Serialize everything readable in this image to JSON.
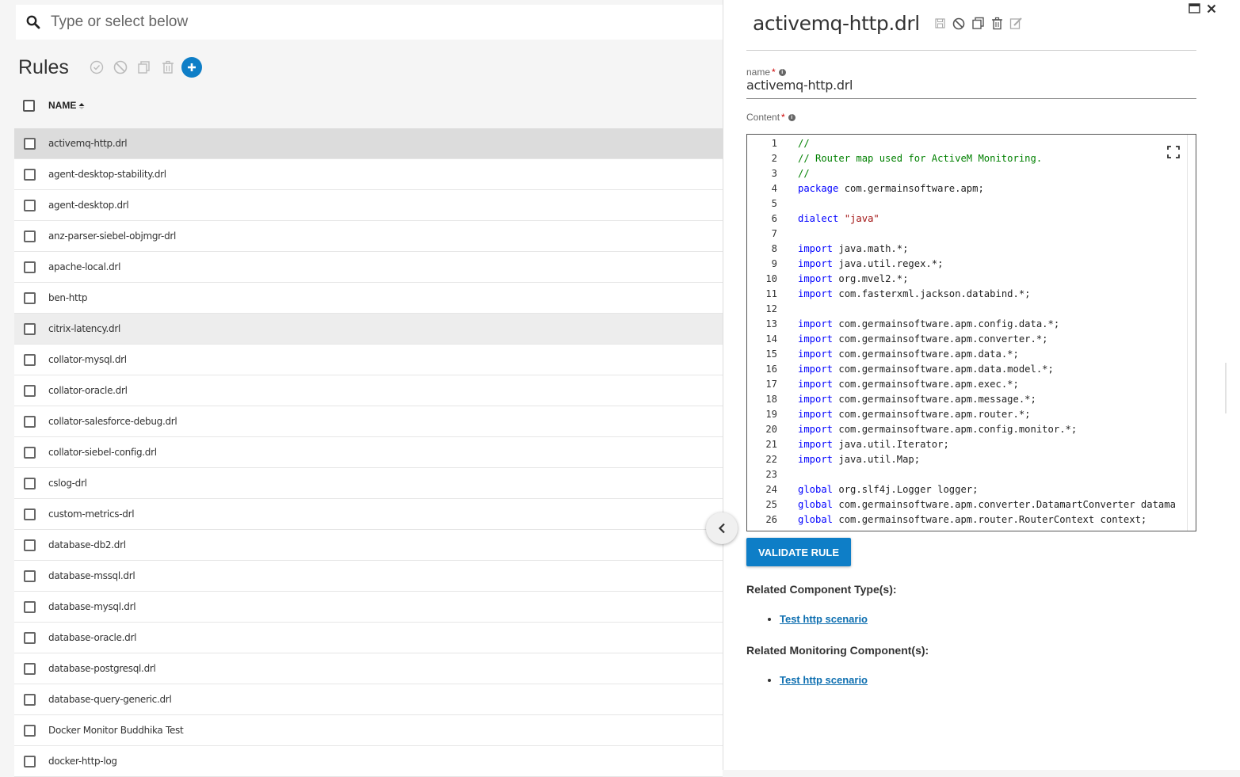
{
  "search": {
    "placeholder": "Type or select below"
  },
  "rules_panel": {
    "title": "Rules",
    "column_header": "NAME",
    "items": [
      "activemq-http.drl",
      "agent-desktop-stability.drl",
      "agent-desktop.drl",
      "anz-parser-siebel-objmgr-drl",
      "apache-local.drl",
      "ben-http",
      "citrix-latency.drl",
      "collator-mysql.drl",
      "collator-oracle.drl",
      "collator-salesforce-debug.drl",
      "collator-siebel-config.drl",
      "cslog-drl",
      "custom-metrics-drl",
      "database-db2.drl",
      "database-mssql.drl",
      "database-mysql.drl",
      "database-oracle.drl",
      "database-postgresql.drl",
      "database-query-generic.drl",
      "Docker Monitor Buddhika Test",
      "docker-http-log"
    ]
  },
  "detail": {
    "title": "activemq-http.drl",
    "name_label": "name",
    "name_value": "activemq-http.drl",
    "content_label": "Content",
    "required_mark": "*",
    "validate_label": "VALIDATE RULE",
    "related_component_types_heading": "Related Component Type(s):",
    "related_component_types": [
      "Test http scenario"
    ],
    "related_monitoring_components_heading": "Related Monitoring Component(s):",
    "related_monitoring_components": [
      "Test http scenario"
    ]
  },
  "code": {
    "line_numbers": [
      "1",
      "2",
      "3",
      "4",
      "5",
      "6",
      "7",
      "8",
      "9",
      "10",
      "11",
      "12",
      "13",
      "14",
      "15",
      "16",
      "17",
      "18",
      "19",
      "20",
      "21",
      "22",
      "23",
      "24",
      "25",
      "26"
    ],
    "lines": [
      {
        "kw": "",
        "text": "//",
        "type": "comment"
      },
      {
        "kw": "",
        "text": "// Router map used for ActiveM Monitoring.",
        "type": "comment"
      },
      {
        "kw": "",
        "text": "//",
        "type": "comment"
      },
      {
        "kw": "package",
        "text": " com.germainsoftware.apm;",
        "type": "code"
      },
      {
        "kw": "",
        "text": "",
        "type": "code"
      },
      {
        "kw": "dialect",
        "text": " ",
        "str": "\"java\"",
        "type": "code"
      },
      {
        "kw": "",
        "text": "",
        "type": "code"
      },
      {
        "kw": "import",
        "text": " java.math.*;",
        "type": "code"
      },
      {
        "kw": "import",
        "text": " java.util.regex.*;",
        "type": "code"
      },
      {
        "kw": "import",
        "text": " org.mvel2.*;",
        "type": "code"
      },
      {
        "kw": "import",
        "text": " com.fasterxml.jackson.databind.*;",
        "type": "code"
      },
      {
        "kw": "",
        "text": "",
        "type": "code"
      },
      {
        "kw": "import",
        "text": " com.germainsoftware.apm.config.data.*;",
        "type": "code"
      },
      {
        "kw": "import",
        "text": " com.germainsoftware.apm.converter.*;",
        "type": "code"
      },
      {
        "kw": "import",
        "text": " com.germainsoftware.apm.data.*;",
        "type": "code"
      },
      {
        "kw": "import",
        "text": " com.germainsoftware.apm.data.model.*;",
        "type": "code"
      },
      {
        "kw": "import",
        "text": " com.germainsoftware.apm.exec.*;",
        "type": "code"
      },
      {
        "kw": "import",
        "text": " com.germainsoftware.apm.message.*;",
        "type": "code"
      },
      {
        "kw": "import",
        "text": " com.germainsoftware.apm.router.*;",
        "type": "code"
      },
      {
        "kw": "import",
        "text": " com.germainsoftware.apm.config.monitor.*;",
        "type": "code"
      },
      {
        "kw": "import",
        "text": " java.util.Iterator;",
        "type": "code"
      },
      {
        "kw": "import",
        "text": " java.util.Map;",
        "type": "code"
      },
      {
        "kw": "",
        "text": "",
        "type": "code"
      },
      {
        "kw": "global",
        "text": " org.slf4j.Logger logger;",
        "type": "code"
      },
      {
        "kw": "global",
        "text": " com.germainsoftware.apm.converter.DatamartConverter datama",
        "type": "code"
      },
      {
        "kw": "global",
        "text": " com.germainsoftware.apm.router.RouterContext context;",
        "type": "code"
      }
    ]
  },
  "colors": {
    "accent": "#0e7ec7",
    "keyword": "#0000ff",
    "comment": "#008000",
    "string": "#a31515",
    "link": "#0e6fb0",
    "required": "#cc0000"
  },
  "icons": {
    "search": "search-icon",
    "validate": "check-circle-icon",
    "disable": "ban-icon",
    "copy": "copy-icon",
    "delete": "trash-icon",
    "add": "plus-icon",
    "save": "save-icon",
    "edit": "edit-icon",
    "maximize": "maximize-icon",
    "close": "close-icon",
    "expand": "fullscreen-icon",
    "collapse": "chevron-left-icon",
    "info": "info-icon",
    "sort": "sort-asc-icon"
  }
}
